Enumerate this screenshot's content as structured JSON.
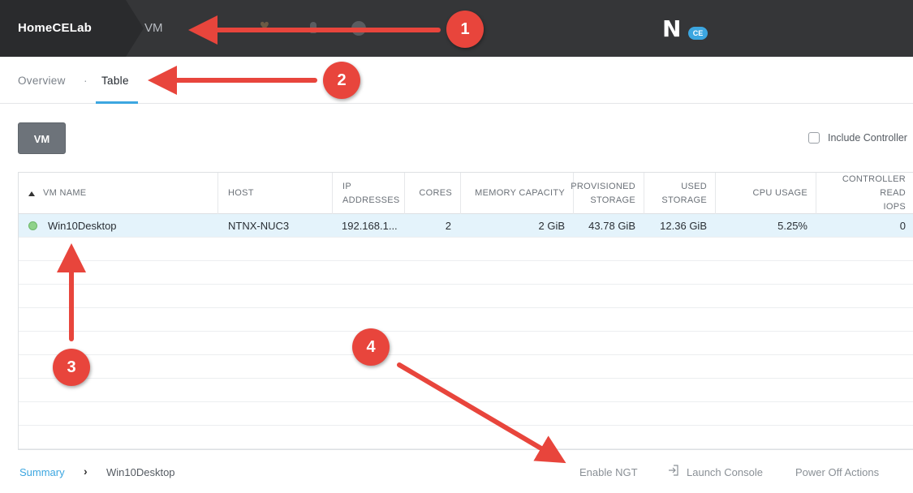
{
  "header": {
    "cluster_name": "HomeCELab",
    "current_view": "VM",
    "logo_badge": "CE",
    "logo_letter": "N",
    "icons": [
      "heart-icon",
      "bell-icon",
      "help-icon"
    ]
  },
  "subnav": {
    "tabs": [
      {
        "label": "Overview",
        "active": false
      },
      {
        "label": "Table",
        "active": true
      }
    ],
    "separator": "·"
  },
  "toolbar": {
    "vm_button": "VM",
    "include_controller_label": "Include Controller",
    "include_controller_checked": false
  },
  "table": {
    "columns": [
      {
        "line1": "VM NAME",
        "line2": ""
      },
      {
        "line1": "HOST",
        "line2": ""
      },
      {
        "line1": "IP",
        "line2": "ADDRESSES"
      },
      {
        "line1": "CORES",
        "line2": ""
      },
      {
        "line1": "MEMORY CAPACITY",
        "line2": ""
      },
      {
        "line1": "PROVISIONED",
        "line2": "STORAGE"
      },
      {
        "line1": "USED",
        "line2": "STORAGE"
      },
      {
        "line1": "CPU USAGE",
        "line2": ""
      },
      {
        "line1": "CONTROLLER READ",
        "line2": "IOPS"
      }
    ],
    "rows": [
      {
        "vm_name": "Win10Desktop",
        "host": "NTNX-NUC3",
        "ip": "192.168.1...",
        "cores": "2",
        "memory": "2 GiB",
        "provisioned": "43.78 GiB",
        "used": "12.36 GiB",
        "cpu": "5.25%",
        "controller_read_iops": "0",
        "status_color": "#8fd28a"
      }
    ]
  },
  "footer": {
    "summary": "Summary",
    "chevron": "›",
    "selected_vm": "Win10Desktop",
    "actions": [
      "Enable NGT",
      "Launch Console",
      "Power Off Actions"
    ]
  },
  "annotations": {
    "badges": [
      "1",
      "2",
      "3",
      "4"
    ],
    "color": "#e8453c"
  },
  "colors": {
    "topbar": "#353638",
    "accent": "#3ca6e0",
    "selected_row": "#e4f3fb"
  }
}
